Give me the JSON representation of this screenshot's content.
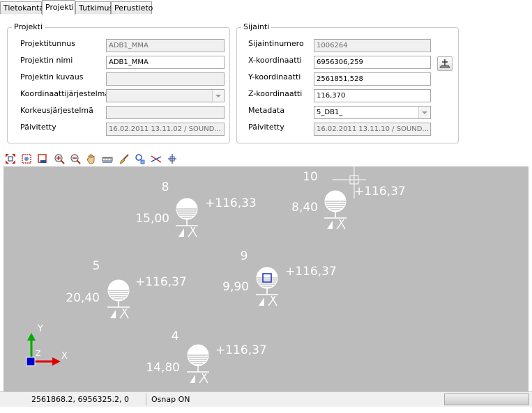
{
  "tabs": [
    {
      "label": "Tietokanta",
      "active": false
    },
    {
      "label": "Projekti",
      "active": true
    },
    {
      "label": "Tutkimus",
      "active": false
    },
    {
      "label": "Perustieto",
      "active": false
    }
  ],
  "projekti": {
    "title": "Projekti",
    "fields": [
      {
        "label": "Projektitunnus",
        "value": "ADB1_MMA"
      },
      {
        "label": "Projektin nimi",
        "value": "ADB1_MMA"
      },
      {
        "label": "Projektin kuvaus",
        "value": ""
      },
      {
        "label": "Koordinaattijärjestelmä",
        "value": ""
      },
      {
        "label": "Korkeusjärjestelmä",
        "value": ""
      },
      {
        "label": "Päivitetty",
        "value": "16.02.2011 13.11.02 / SOUND..."
      }
    ]
  },
  "sijainti": {
    "title": "Sijainti",
    "fields": [
      {
        "label": "Sijaintinumero",
        "value": "1006264"
      },
      {
        "label": "X-koordinaatti",
        "value": "6956306,259"
      },
      {
        "label": "Y-koordinaatti",
        "value": "2561851,528"
      },
      {
        "label": "Z-koordinaatti",
        "value": "116,370"
      },
      {
        "label": "Metadata",
        "value": "5_DB1_"
      },
      {
        "label": "Päivitetty",
        "value": "16.02.2011 13.11.10 / SOUND..."
      }
    ]
  },
  "toolbar_icons": [
    "zoom-extents-icon",
    "zoom-window-icon",
    "zoom-previous-icon",
    "zoom-in-icon",
    "zoom-out-icon",
    "pan-hand-icon",
    "measure-distance-icon",
    "clear-brush-icon",
    "select-point-icon",
    "cut-line-icon",
    "snap-point-icon"
  ],
  "cad": {
    "points": [
      {
        "id": "8",
        "depth": "15,00",
        "elevation": "+116,33",
        "selected": false
      },
      {
        "id": "10",
        "depth": "8,40",
        "elevation": "+116,37",
        "selected": false
      },
      {
        "id": "5",
        "depth": "20,40",
        "elevation": "+116,37",
        "selected": false
      },
      {
        "id": "9",
        "depth": "9,90",
        "elevation": "+116,37",
        "selected": true
      },
      {
        "id": "4",
        "depth": "14,80",
        "elevation": "+116,37",
        "selected": false
      }
    ],
    "axis": {
      "y": "Y",
      "x": "X",
      "z": "Z"
    }
  },
  "status": {
    "coordinates": "2561868.2, 6956325.2, 0",
    "osnap": "Osnap ON"
  },
  "colors": {
    "canvas": "#bcbcbc",
    "axis_y": "#00aa00",
    "axis_x": "#e00000",
    "axis_origin": "#0000cc"
  }
}
